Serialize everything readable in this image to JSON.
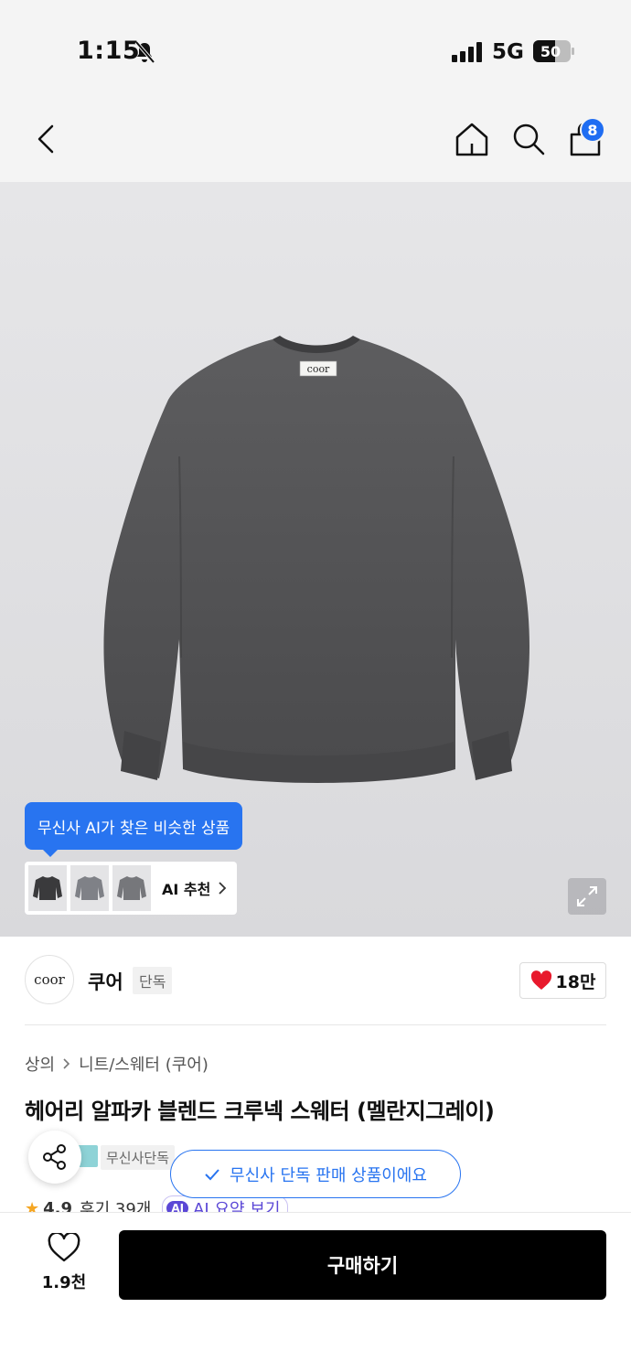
{
  "status_bar": {
    "time": "1:15",
    "network": "5G",
    "battery": "50"
  },
  "header": {
    "cart_count": "8"
  },
  "hero": {
    "label_text": "coor",
    "ai_tooltip": "무신사 AI가 찾은 비슷한 상품",
    "ai_recommend": "AI 추천"
  },
  "brand": {
    "logo_text": "coor",
    "name": "쿠어",
    "tag": "단독",
    "likes": "18만"
  },
  "product": {
    "breadcrumb": [
      "상의",
      "니트/스웨터 (쿠어)"
    ],
    "title": "헤어리 알파카 블렌드 크루넥 스웨터 (멜란지그레이)",
    "exclusive_badge": "무신사단독",
    "toast": "무신사 단독 판매 상품이에요",
    "rating": "4.9",
    "reviews": "후기 39개",
    "ai_chip": "AI",
    "ai_summary": "AI 요약 보기"
  },
  "bottom": {
    "wish_count": "1.9천",
    "buy_label": "구매하기"
  },
  "colors": {
    "accent": "#2874f0",
    "heart": "#e8192c",
    "buy": "#000000",
    "ai_purple": "#5b47d6"
  }
}
